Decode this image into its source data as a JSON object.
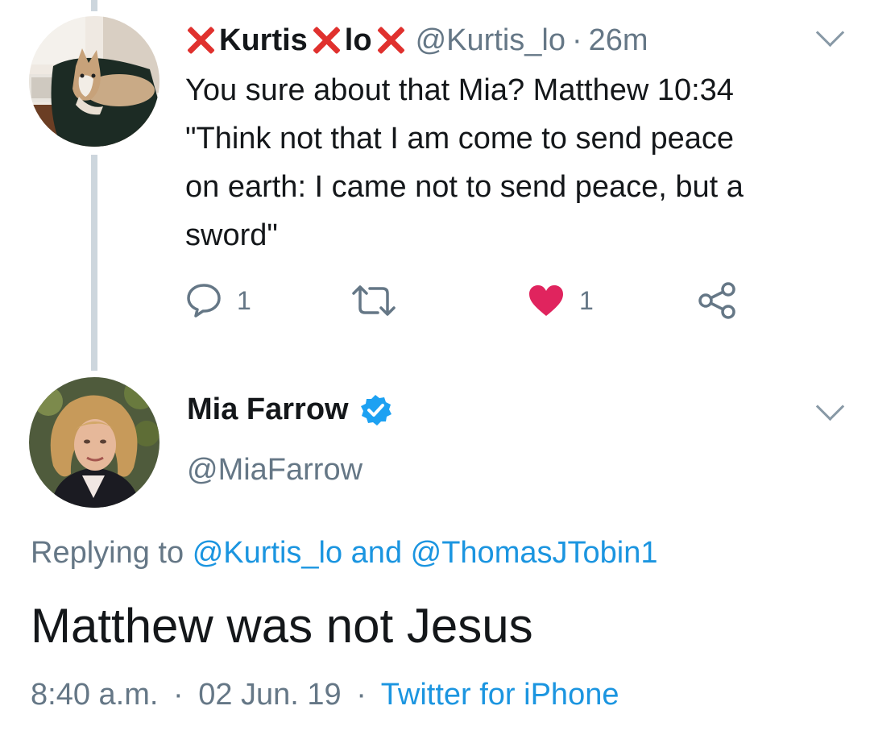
{
  "thread": {
    "tweet1": {
      "avatar_icon": "husky-dog-avatar",
      "display_name_parts": [
        "Kurtis",
        "lo"
      ],
      "display_name_emoji": "cross-mark-icon",
      "handle": "@Kurtis_lo",
      "separator": "·",
      "time": "26m",
      "text": "You sure about that Mia? Matthew 10:34\n\"Think not that I am come to send peace\non earth: I came not to send peace, but a\nsword\"",
      "reply_count": "1",
      "retweet_count": "",
      "like_count": "1",
      "liked": true
    },
    "tweet2": {
      "avatar_icon": "blonde-woman-avatar",
      "display_name": "Mia Farrow",
      "verified": true,
      "handle": "@MiaFarrow",
      "replying_prefix": "Replying to",
      "replying_user1": "@Kurtis_lo",
      "replying_and": "and",
      "replying_user2": "@ThomasJTobin1",
      "text": "Matthew was not Jesus",
      "time": "8:40 a.m.",
      "separator": "·",
      "date": "02 Jun. 19",
      "source": "Twitter for iPhone"
    }
  },
  "colors": {
    "like": "#e0245e",
    "link": "#1b95e0",
    "muted": "#657786",
    "cross": "#e0312e",
    "thread_line": "#cdd6dd"
  }
}
